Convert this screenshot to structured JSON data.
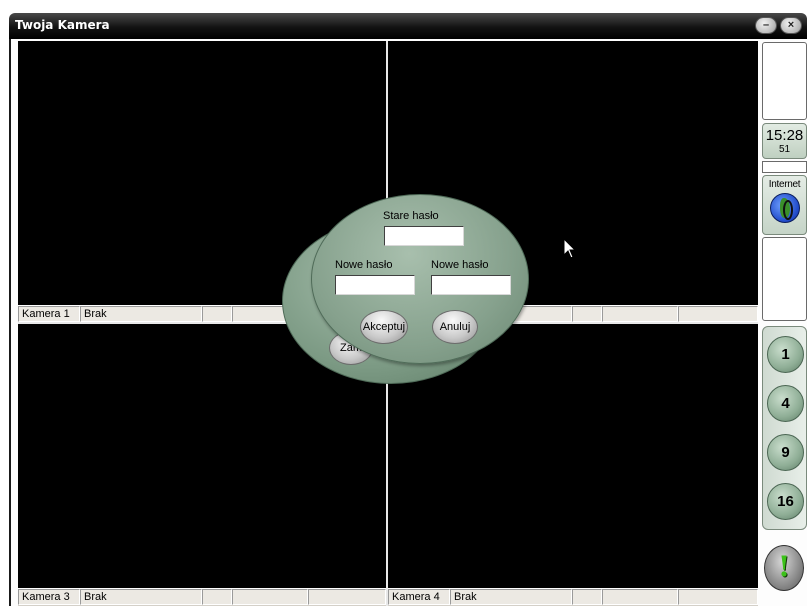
{
  "window": {
    "title": "Twoja Kamera",
    "minimize_icon": "minimize-icon",
    "close_icon": "close-icon",
    "minimize_glyph": "–",
    "close_glyph": "×"
  },
  "cameras": [
    {
      "name": "Kamera 1",
      "status": "Brak"
    },
    {
      "name": "",
      "status": ""
    },
    {
      "name": "Kamera 3",
      "status": "Brak"
    },
    {
      "name": "Kamera 4",
      "status": "Brak"
    }
  ],
  "dialog": {
    "old_password_label": "Stare hasło",
    "new_password_label": "Nowe hasło",
    "new_password_confirm_label": "Nowe hasło",
    "old_password_value": "",
    "new_password_value": "",
    "new_password_confirm_value": "",
    "accept_label": "Akceptuj",
    "cancel_label": "Anuluj",
    "back_button_label": "Zam"
  },
  "side_panel": {
    "clock_time": "15:28",
    "clock_seconds": "51",
    "internet_label": "Internet",
    "internet_icon": "globe-icon",
    "layout_buttons": [
      "1",
      "4",
      "9",
      "16"
    ],
    "alert_glyph": "!",
    "alert_icon": "alert-icon"
  },
  "colors": {
    "dialog_green": "#86a18d",
    "titlebar": "#000000",
    "camera_bg": "#000000"
  }
}
